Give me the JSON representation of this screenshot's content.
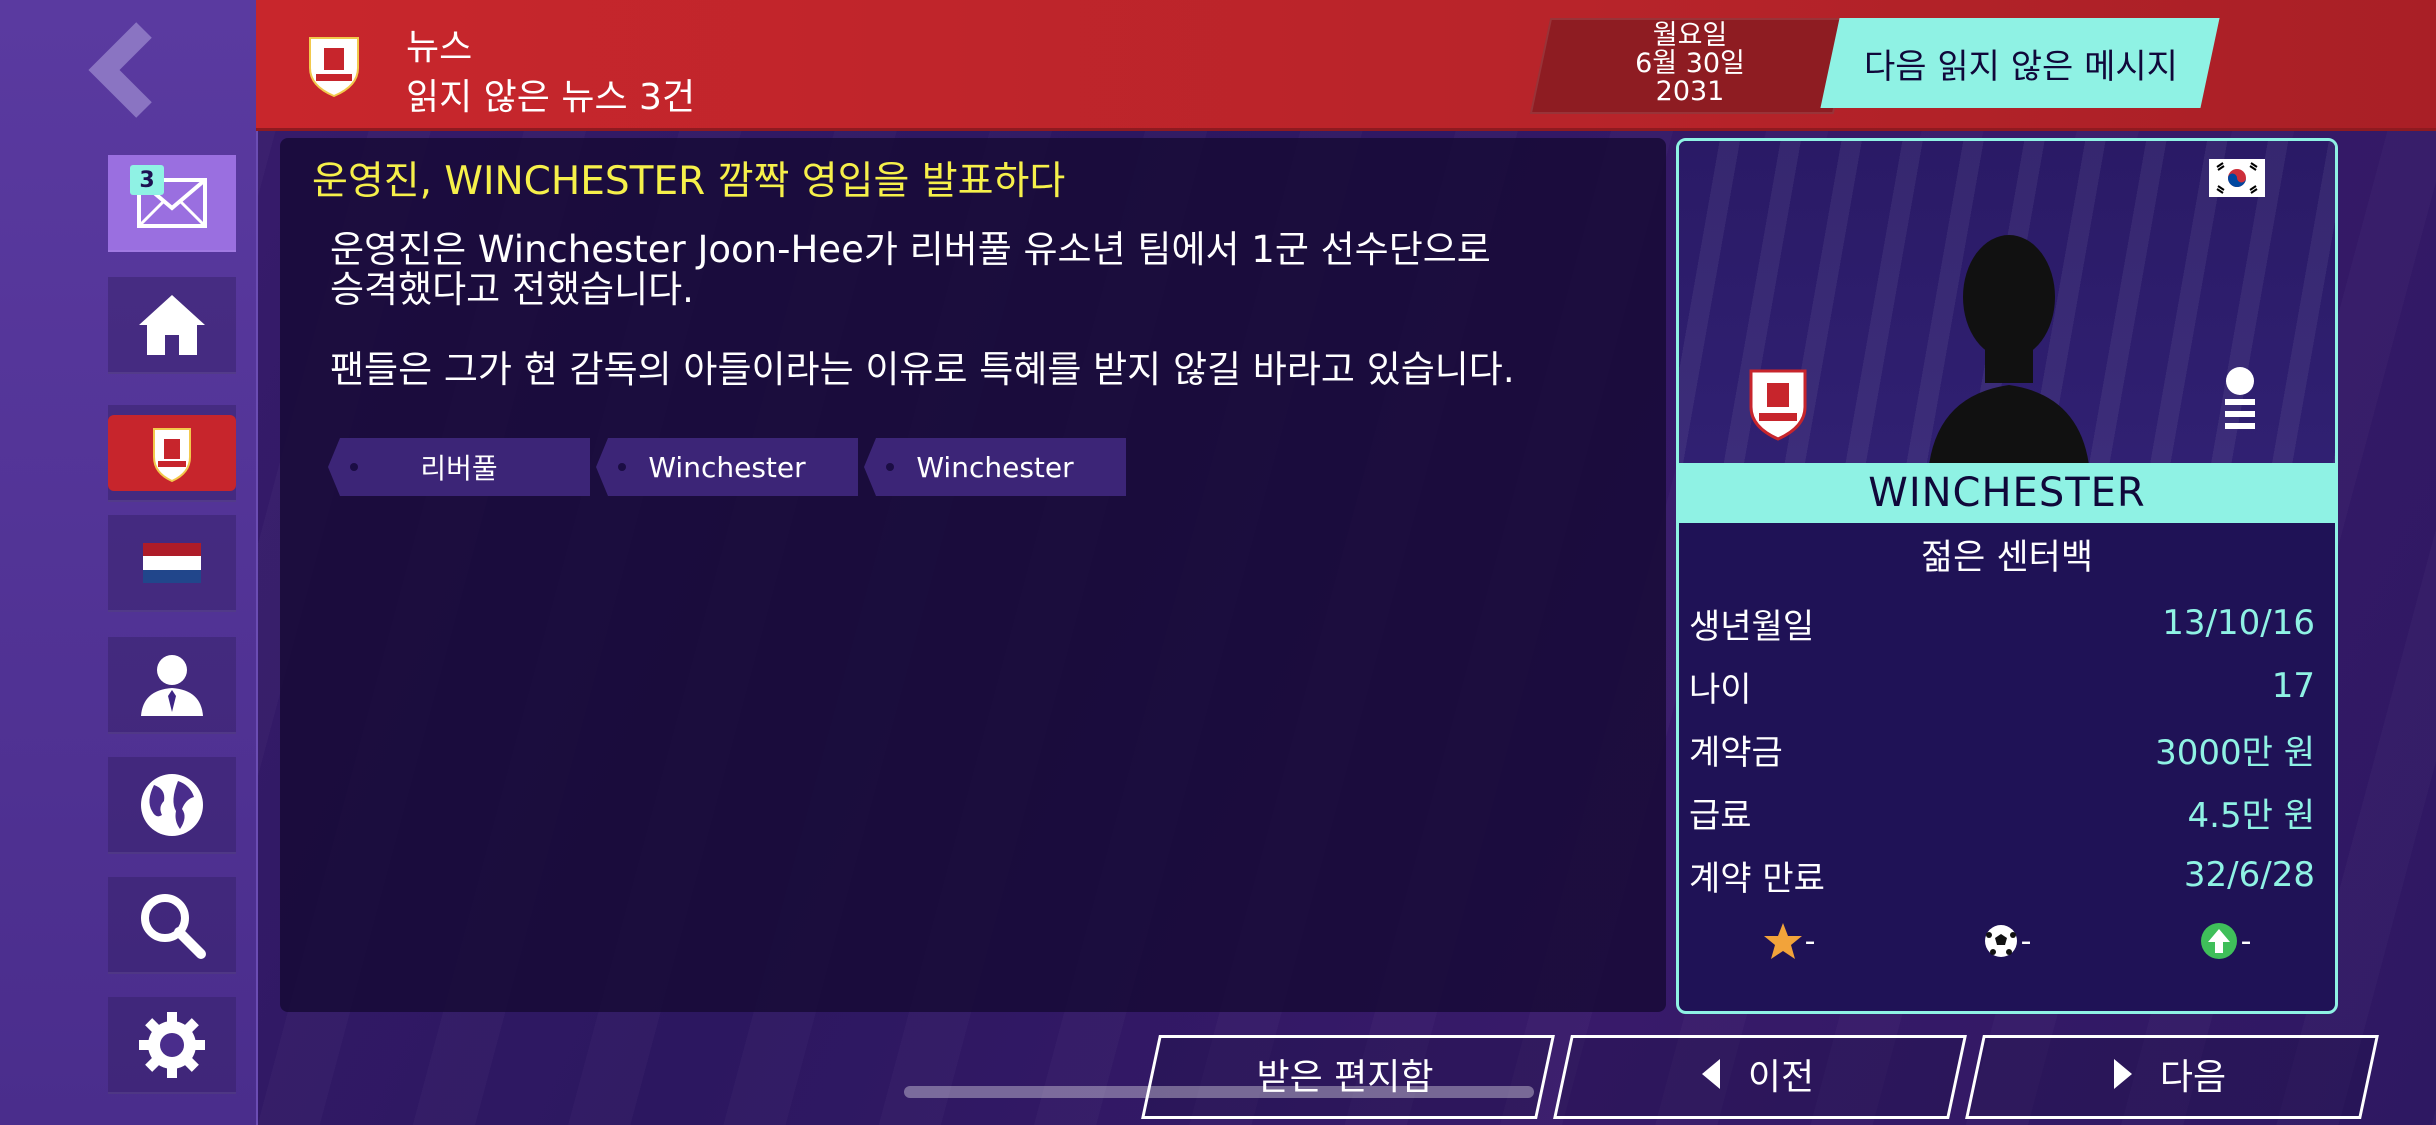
{
  "header": {
    "title": "뉴스",
    "subtitle": "읽지 않은 뉴스 3건",
    "date": {
      "weekday": "월요일",
      "day": "6월 30일",
      "year": "2031"
    },
    "next_unread_label": "다음 읽지 않은 메시지"
  },
  "sidebar": {
    "mail_count": "3",
    "items": [
      {
        "name": "inbox",
        "icon": "envelope-icon"
      },
      {
        "name": "home",
        "icon": "home-icon"
      },
      {
        "name": "club",
        "icon": "liverpool-crest-icon"
      },
      {
        "name": "nation",
        "icon": "netherlands-flag-icon"
      },
      {
        "name": "staff",
        "icon": "manager-icon"
      },
      {
        "name": "world",
        "icon": "globe-icon"
      },
      {
        "name": "search",
        "icon": "search-icon"
      },
      {
        "name": "settings",
        "icon": "gear-icon"
      }
    ]
  },
  "article": {
    "headline": "운영진, WINCHESTER 깜짝 영입을 발표하다",
    "para1_line1": "운영진은 Winchester Joon-Hee가 리버풀 유소년 팀에서 1군 선수단으로",
    "para1_line2": "승격했다고 전했습니다.",
    "para2": "팬들은 그가 현 감독의 아들이라는 이유로 특혜를 받지 않길 바라고 있습니다.",
    "tags": [
      "리버풀",
      "Winchester",
      "Winchester"
    ]
  },
  "player": {
    "name": "WINCHESTER",
    "position": "젊은 센터백",
    "stats": [
      {
        "label": "생년월일",
        "value": "13/10/16"
      },
      {
        "label": "나이",
        "value": "17"
      },
      {
        "label": "계약금",
        "value": "3000만 원"
      },
      {
        "label": "급료",
        "value": "4.5만 원"
      },
      {
        "label": "계약 만료",
        "value": "32/6/28"
      }
    ],
    "star_value": "-",
    "ball_value": "-",
    "potential_value": "-"
  },
  "buttons": {
    "inbox_label": "받은 편지함",
    "prev_label": "이전",
    "next_label": "다음"
  },
  "colors": {
    "accent": "#8ff2e4",
    "header_red": "#c8262c",
    "headline_yellow": "#f6f04a",
    "background": "#2c1760"
  }
}
